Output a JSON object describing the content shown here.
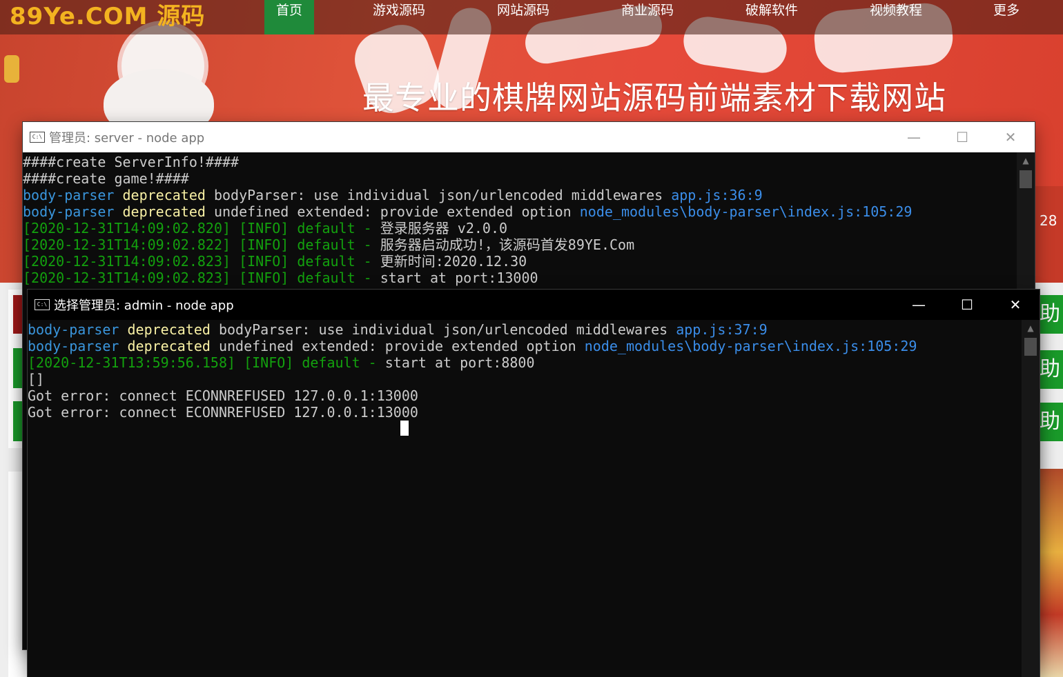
{
  "site": {
    "logo": "89Ye.COM 源码",
    "nav": [
      "首页",
      "游戏源码",
      "网站源码",
      "商业源码",
      "破解软件",
      "视频教程",
      "更多"
    ],
    "slogan": "最专业的棋牌网站源码前端素材下载网站",
    "side_number": "28",
    "side_button_text": "助",
    "colors": {
      "nav_active": "#1f8a3a",
      "logo": "#f3b320",
      "banner": "#e0533a"
    }
  },
  "win1": {
    "title": "管理员:  server - node  app",
    "lines": [
      [
        [
          "####create ServerInfo!####",
          "white"
        ]
      ],
      [
        [
          "####create game!####",
          "white"
        ]
      ],
      [
        [
          "body-parser ",
          "cyan"
        ],
        [
          "deprecated ",
          "yellow"
        ],
        [
          "bodyParser: use individual json/urlencoded middlewares ",
          "white"
        ],
        [
          "app.js:36:9",
          "blue"
        ]
      ],
      [
        [
          "body-parser ",
          "cyan"
        ],
        [
          "deprecated ",
          "yellow"
        ],
        [
          "undefined extended: provide extended option ",
          "white"
        ],
        [
          "node_modules\\body-parser\\index.js:105:29",
          "blue"
        ]
      ],
      [
        [
          "[2020-12-31T14:09:02.820] [INFO] default - ",
          "green"
        ],
        [
          "登录服务器 v2.0.0",
          "white"
        ]
      ],
      [
        [
          "[2020-12-31T14:09:02.822] [INFO] default - ",
          "green"
        ],
        [
          "服务器启动成功!，该源码首发89YE.Com",
          "white"
        ]
      ],
      [
        [
          "[2020-12-31T14:09:02.823] [INFO] default - ",
          "green"
        ],
        [
          "更新时间:2020.12.30",
          "white"
        ]
      ],
      [
        [
          "[2020-12-31T14:09:02.823] [INFO] default - ",
          "green"
        ],
        [
          "start at port:13000",
          "white"
        ]
      ]
    ]
  },
  "win2": {
    "title": "选择管理员:  admin - node  app",
    "lines": [
      [
        [
          "body-parser ",
          "cyan"
        ],
        [
          "deprecated ",
          "yellow"
        ],
        [
          "bodyParser: use individual json/urlencoded middlewares ",
          "white"
        ],
        [
          "app.js:37:9",
          "blue"
        ]
      ],
      [
        [
          "body-parser ",
          "cyan"
        ],
        [
          "deprecated ",
          "yellow"
        ],
        [
          "undefined extended: provide extended option ",
          "white"
        ],
        [
          "node_modules\\body-parser\\index.js:105:29",
          "blue"
        ]
      ],
      [
        [
          "[2020-12-31T13:59:56.158] [INFO] default - ",
          "green"
        ],
        [
          "start at port:8800",
          "white"
        ]
      ],
      [
        [
          "[]",
          "white"
        ]
      ],
      [
        [
          "Got error: connect ECONNREFUSED 127.0.0.1:13000",
          "white"
        ]
      ],
      [
        [
          "Got error: connect ECONNREFUSED 127.0.0.1:13000",
          "white"
        ]
      ]
    ]
  },
  "icons": {
    "window": "cmd-icon",
    "minimize": "minimize-icon",
    "maximize": "maximize-icon",
    "close": "close-icon"
  },
  "console_colors": {
    "cyan": "#3a96dd",
    "yellow": "#f9f1a5",
    "green": "#13a10e",
    "blue": "#3b8eea",
    "white": "#cccccc"
  }
}
